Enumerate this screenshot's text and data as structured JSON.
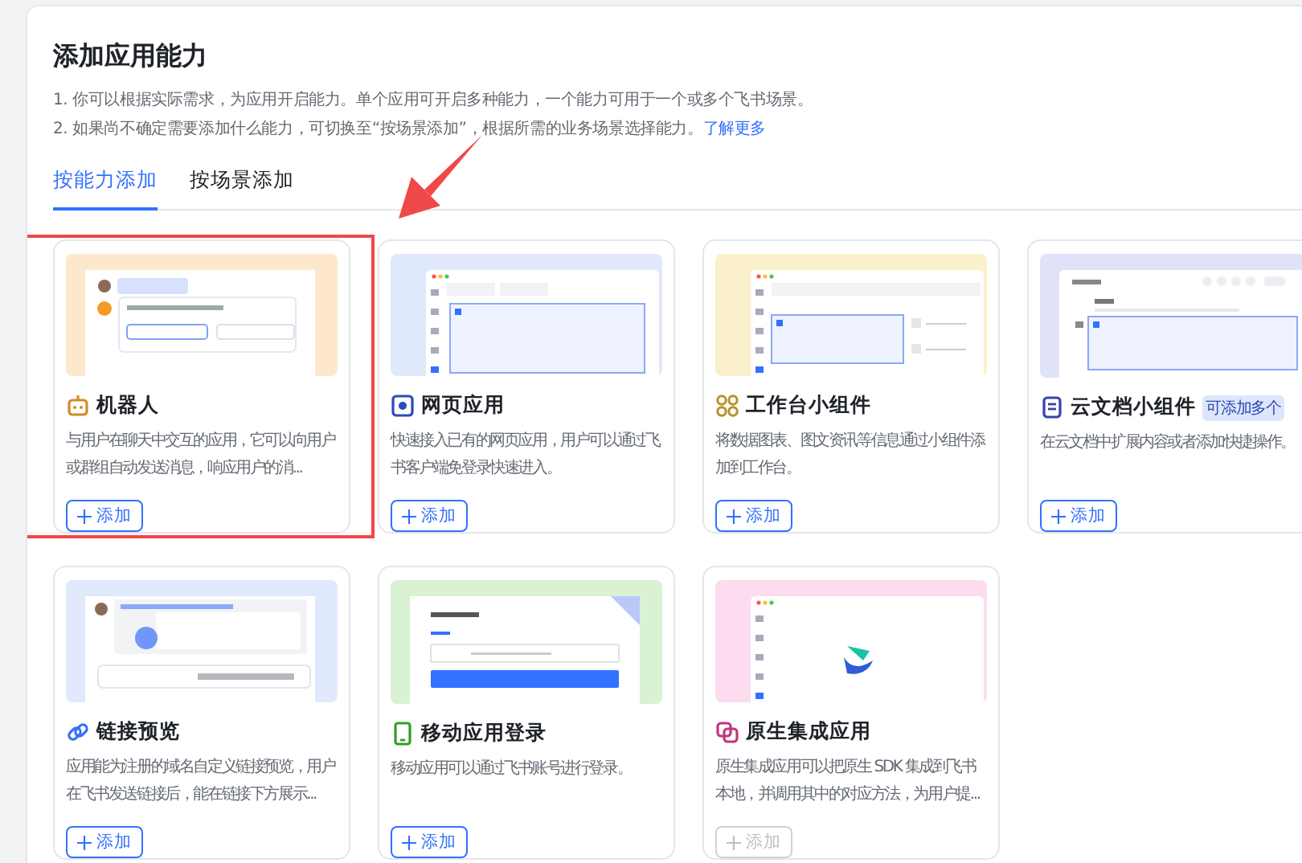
{
  "header": {
    "title": "添加应用能力",
    "notes": [
      "1. 你可以根据实际需求，为应用开启能力。单个应用可开启多种能力，一个能力可用于一个或多个飞书场景。",
      "2. 如果尚不确定需要添加什么能力，可切换至“按场景添加”，根据所需的业务场景选择能力。"
    ],
    "link": "了解更多"
  },
  "tabs": [
    {
      "label": "按能力添加",
      "selected": true
    },
    {
      "label": "按场景添加",
      "selected": false
    }
  ],
  "pointer_arrow": true,
  "cards": [
    {
      "kind": "robot",
      "color": "#fde8cc",
      "title": "机器人",
      "description": "与用户在聊天中交互的应用，它可以向用户或群组自动发送消息，响应用户的消...",
      "button": {
        "label": "添加",
        "disabled": false
      },
      "highlighted": true
    },
    {
      "kind": "webpage",
      "color": "#e0e8fc",
      "title": "网页应用",
      "description": "快速接入已有的网页应用，用户可以通过飞书客户端免登录快速进入。",
      "button": {
        "label": "添加",
        "disabled": false
      },
      "highlighted": false
    },
    {
      "kind": "widget",
      "color": "#fbf0cc",
      "title": "工作台小组件",
      "description": "将数据图表、图文资讯等信息通过小组件添加到工作台。",
      "button": {
        "label": "添加",
        "disabled": false
      },
      "highlighted": false
    },
    {
      "kind": "doc",
      "color": "#e0e3f8",
      "title": "云文档小组件",
      "badge": "可添加多个",
      "description": "在云文档中扩展内容或者添加快捷操作。",
      "button": {
        "label": "添加",
        "disabled": false
      },
      "highlighted": false
    },
    {
      "kind": "link",
      "color": "#e1e9fd",
      "title": "链接预览",
      "description": "应用能为注册的域名自定义链接预览，用户在飞书发送链接后，能在链接下方展示...",
      "button": {
        "label": "添加",
        "disabled": false
      },
      "highlighted": false
    },
    {
      "kind": "mobile",
      "color": "#d8f2d3",
      "title": "移动应用登录",
      "description": "移动应用可以通过飞书账号进行登录。",
      "button": {
        "label": "添加",
        "disabled": false
      },
      "highlighted": false
    },
    {
      "kind": "native",
      "color": "#fcdcee",
      "title": "原生集成应用",
      "description": "原生集成应用可以把原生 SDK 集成到飞书本地，并调用其中的对应方法，为用户提...",
      "button": {
        "label": "添加",
        "disabled": true
      },
      "highlighted": false
    }
  ]
}
